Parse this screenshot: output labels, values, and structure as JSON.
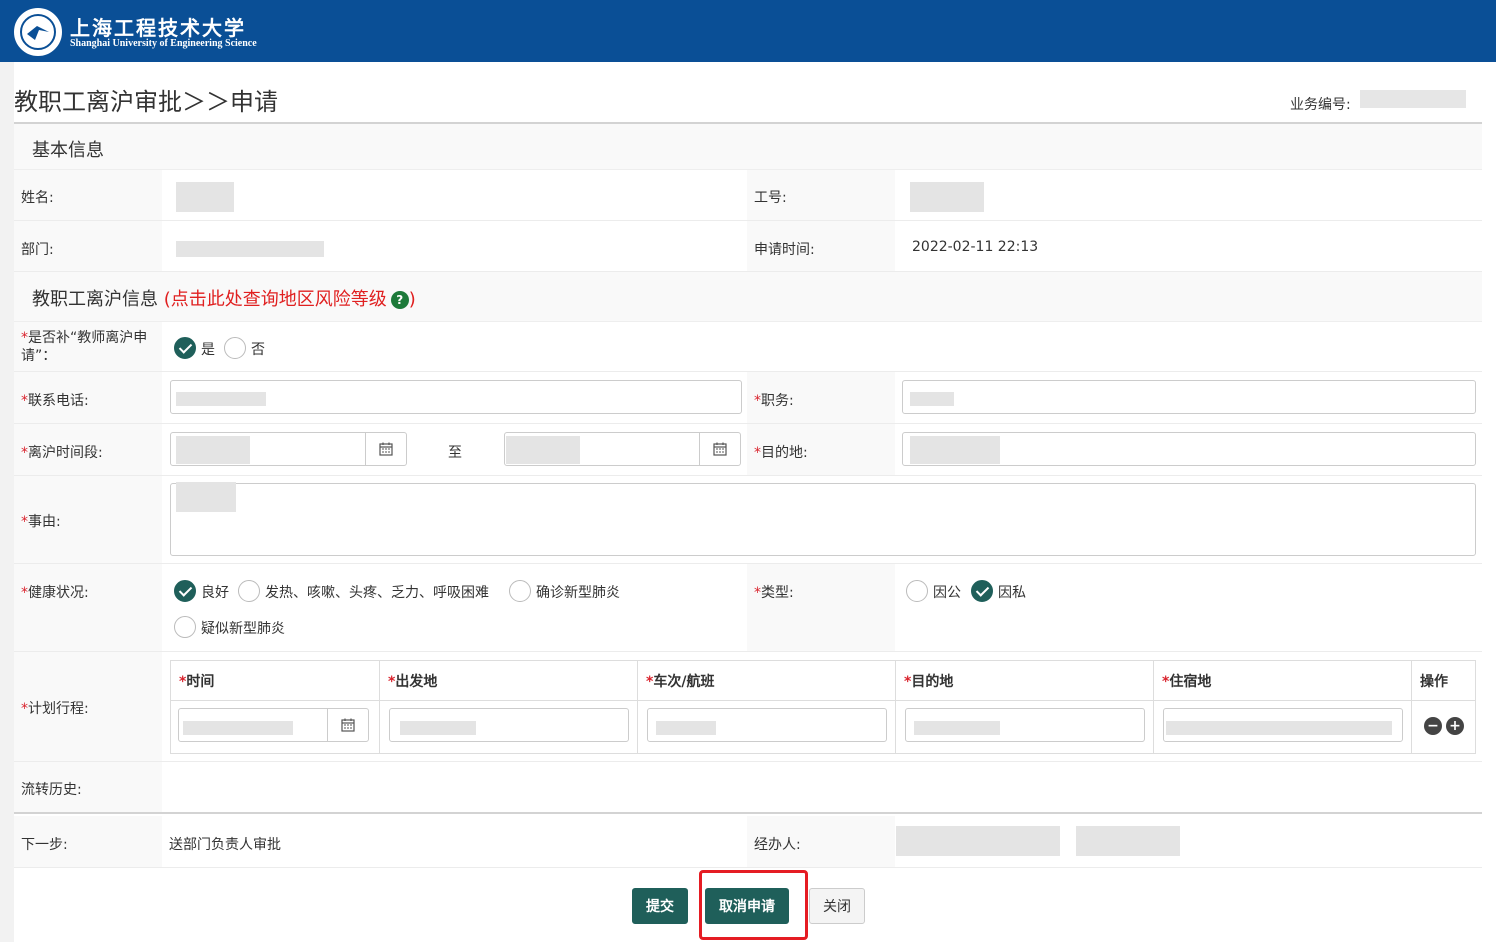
{
  "header": {
    "school_name_cn": "上海工程技术大学",
    "school_name_en": "Shanghai University of Engineering Science"
  },
  "page": {
    "title": "教职工离沪审批＞＞申请",
    "business_no_label": "业务编号:"
  },
  "basic_info": {
    "section_title": "基本信息",
    "name_label": "姓名:",
    "staff_no_label": "工号:",
    "dept_label": "部门:",
    "apply_time_label": "申请时间:",
    "apply_time_value": "2022-02-11 22:13"
  },
  "leave_info": {
    "section_title": "教职工离沪信息",
    "risk_link": "(点击此处查询地区风险等级",
    "risk_link_close": ")",
    "help_icon": "?",
    "supplement_label": "是否补“教师离沪申请”：",
    "supplement_options": [
      "是",
      "否"
    ],
    "phone_label": "联系电话:",
    "position_label": "职务:",
    "period_label": "离沪时间段:",
    "period_to": "至",
    "destination_label": "目的地:",
    "reason_label": "事由:",
    "health_label": "健康状况:",
    "health_options": [
      "良好",
      "发热、咳嗽、头疼、乏力、呼吸困难",
      "确诊新型肺炎",
      "疑似新型肺炎"
    ],
    "type_label": "类型:",
    "type_options": [
      "因公",
      "因私"
    ],
    "plan_label": "计划行程:",
    "plan_columns": [
      "时间",
      "出发地",
      "车次/航班",
      "目的地",
      "住宿地",
      "操作"
    ],
    "history_label": "流转历史:",
    "required_mark": "*"
  },
  "footer_info": {
    "next_step_label": "下一步:",
    "next_step_value": "送部门负责人审批",
    "handler_label": "经办人:"
  },
  "buttons": {
    "submit": "提交",
    "cancel_apply": "取消申请",
    "close": "关闭"
  },
  "icons": {
    "calendar": "calendar-icon",
    "remove": "minus-circle-icon",
    "add": "plus-circle-icon"
  },
  "colors": {
    "header_blue": "#0a4f96",
    "primary_green": "#1f5f5a",
    "required_red": "#d9232d",
    "highlight_red": "#e51c23"
  }
}
